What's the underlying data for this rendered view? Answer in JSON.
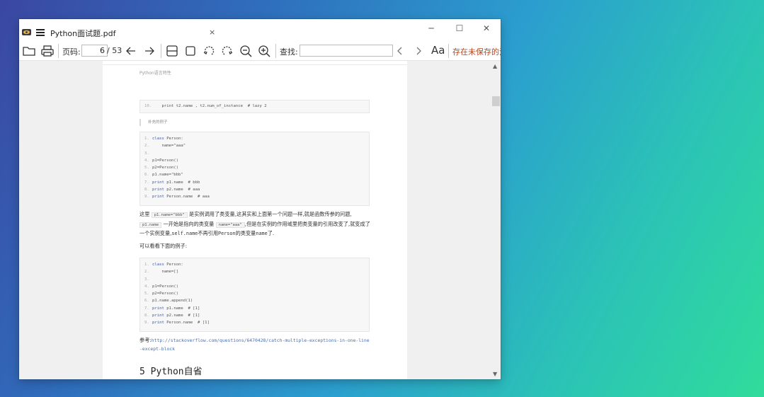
{
  "window": {
    "title": "Python面试题.pdf",
    "tab_close": "×",
    "minimize": "─",
    "maximize": "☐",
    "close": "✕"
  },
  "toolbar": {
    "page_label": "页码:",
    "page_value": "6",
    "page_total": "/ 53",
    "search_label": "查找:",
    "search_value": "",
    "font_button": "Aa",
    "unsaved_notice": "存在未保存的注释"
  },
  "document": {
    "running_head": "Python语言特性",
    "code_block_1": [
      {
        "ln": "10.",
        "code": "    print t2.name , t2.num_of_instance  # lazy 2"
      }
    ],
    "quote": "补充的例子",
    "code_block_2": [
      {
        "ln": "1.",
        "kw": "class",
        "code": " Person:"
      },
      {
        "ln": "2.",
        "kw": "",
        "code": "    name=\"aaa\""
      },
      {
        "ln": "3.",
        "kw": "",
        "code": ""
      },
      {
        "ln": "4.",
        "kw": "",
        "code": "p1=Person()"
      },
      {
        "ln": "5.",
        "kw": "",
        "code": "p2=Person()"
      },
      {
        "ln": "6.",
        "kw": "",
        "code": "p1.name=\"bbb\""
      },
      {
        "ln": "7.",
        "kw": "print",
        "code": " p1.name  # bbb"
      },
      {
        "ln": "8.",
        "kw": "print",
        "code": " p2.name  # aaa"
      },
      {
        "ln": "9.",
        "kw": "print",
        "code": " Person.name  # aaa"
      }
    ],
    "para1": {
      "t1": "这里",
      "c1": "p1.name=\"bbb\"",
      "t2": "是实例调用了类变量,这其实和上面第一个问题一样,就是函数传参的问题,",
      "c2": "p1.name",
      "t3": "一开始是指向的类变量",
      "c3": "name=\"aaa\"",
      "t4": ",但是在实例的作用域里把类变量的引用改变了,就变成了一个实例变量,",
      "m1": "self.name",
      "t5": "不再引用",
      "m2": "Person",
      "t6": "的类变量",
      "m3": "name",
      "t7": "了."
    },
    "para2": "可以看看下面的例子:",
    "code_block_3": [
      {
        "ln": "1.",
        "kw": "class",
        "code": " Person:"
      },
      {
        "ln": "2.",
        "kw": "",
        "code": "    name=[]"
      },
      {
        "ln": "3.",
        "kw": "",
        "code": ""
      },
      {
        "ln": "4.",
        "kw": "",
        "code": "p1=Person()"
      },
      {
        "ln": "5.",
        "kw": "",
        "code": "p2=Person()"
      },
      {
        "ln": "6.",
        "kw": "",
        "code": "p1.name.append(1)"
      },
      {
        "ln": "7.",
        "kw": "print",
        "code": " p1.name  # [1]"
      },
      {
        "ln": "8.",
        "kw": "print",
        "code": " p2.name  # [1]"
      },
      {
        "ln": "9.",
        "kw": "print",
        "code": " Person.name  # [1]"
      }
    ],
    "ref_label": "参考:",
    "ref_link": "http://stackoverflow.com/questions/6470428/catch-multiple-exceptions-in-one-line-except-block",
    "section_heading": "5 Python自省"
  }
}
